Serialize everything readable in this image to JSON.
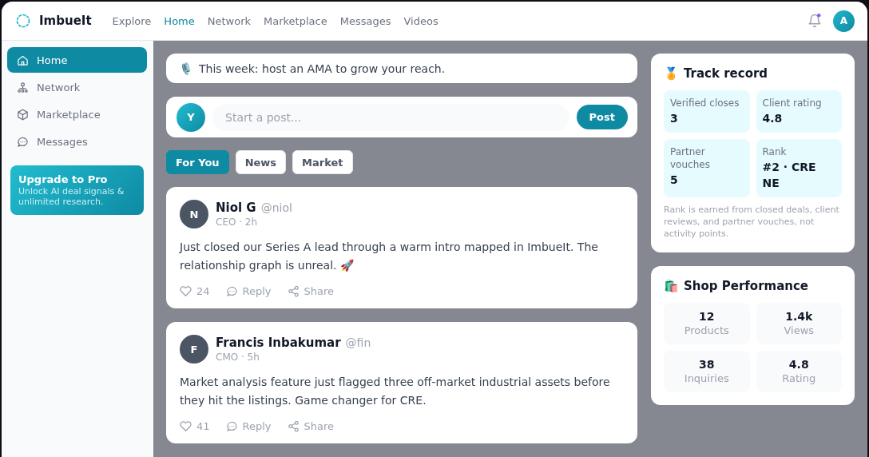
{
  "brand": {
    "name": "ImbueIt"
  },
  "top_nav": [
    {
      "label": "Explore",
      "selected": false
    },
    {
      "label": "Home",
      "selected": true
    },
    {
      "label": "Network",
      "selected": false
    },
    {
      "label": "Marketplace",
      "selected": false
    },
    {
      "label": "Messages",
      "selected": false
    },
    {
      "label": "Videos",
      "selected": false
    }
  ],
  "notifications": {
    "unread": true
  },
  "user_avatar": {
    "initial": "A"
  },
  "sidebar": {
    "items": [
      {
        "label": "Home",
        "selected": true
      },
      {
        "label": "Network",
        "selected": false
      },
      {
        "label": "Marketplace",
        "selected": false
      },
      {
        "label": "Messages",
        "selected": false
      }
    ],
    "promo": {
      "title": "Upgrade to Pro",
      "text": "Unlock AI deal signals & unlimited research."
    }
  },
  "banner": {
    "emoji": "🎙️",
    "text": "This week: host an AMA to grow your reach."
  },
  "composer": {
    "avatar": "Y",
    "placeholder": "Start a post...",
    "button": "Post"
  },
  "feed_tabs": [
    {
      "label": "For You",
      "selected": true
    },
    {
      "label": "News",
      "selected": false
    },
    {
      "label": "Market",
      "selected": false
    }
  ],
  "posts": [
    {
      "initial": "N",
      "name": "Niol G",
      "handle": "@niol",
      "meta": "CEO · 2h",
      "text": "Just closed our Series A lead through a warm intro mapped in ImbueIt. The relationship graph is unreal. 🚀",
      "likes": "24",
      "reply": "Reply",
      "share": "Share"
    },
    {
      "initial": "F",
      "name": "Francis Inbakumar",
      "handle": "@fin",
      "meta": "CMO · 5h",
      "text": "Market analysis feature just flagged three off-market industrial assets before they hit the listings. Game changer for CRE.",
      "likes": "41",
      "reply": "Reply",
      "share": "Share"
    }
  ],
  "track_record": {
    "emoji": "🏅",
    "title": "Track record",
    "stats": [
      {
        "label": "Verified closes",
        "value": "3"
      },
      {
        "label": "Client rating",
        "value": "4.8"
      },
      {
        "label": "Partner vouches",
        "value": "5"
      },
      {
        "label": "Rank",
        "value": "#2 · CRE NE"
      }
    ],
    "note": "Rank is earned from closed deals, client reviews, and partner vouches, not activity points."
  },
  "shop_performance": {
    "emoji": "🛍️",
    "title": "Shop Performance",
    "stats": [
      {
        "value": "12",
        "label": "Products"
      },
      {
        "value": "1.4k",
        "label": "Views"
      },
      {
        "value": "38",
        "label": "Inquiries"
      },
      {
        "value": "4.8",
        "label": "Rating"
      }
    ]
  }
}
